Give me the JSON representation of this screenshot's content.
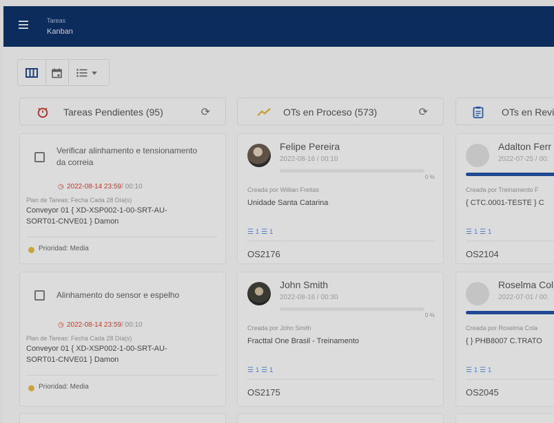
{
  "header": {
    "section": "Tareas",
    "view": "Kanban"
  },
  "toolbar": {
    "icons": [
      "kanban-view-icon",
      "calendar-view-icon",
      "list-view-icon",
      "dropdown-caret-icon"
    ]
  },
  "columns": [
    {
      "title": "Tareas Pendientes (95)",
      "icon": "timer-icon",
      "cards": [
        {
          "title_line1": "Verificar alinhamento e tensionamento",
          "title_line2": "da correia",
          "due": "2022-08-14 23:59",
          "due_suffix": "/ 00:10",
          "plan": "Plan de Tareas: Fecha Cada 28 Día(s)",
          "asset_line1": "Conveyor 01 { XD-XSP002-1-00-SRT-AU-",
          "asset_line2": "SORT01-CNVE01 } Damon",
          "priority": "Prioridad: Media"
        },
        {
          "title_line1": "Alinhamento do sensor e espelho",
          "title_line2": "",
          "due": "2022-08-14 23:59",
          "due_suffix": "/ 00:10",
          "plan": "Plan de Tareas: Fecha Cada 28 Día(s)",
          "asset_line1": "Conveyor 01 { XD-XSP002-1-00-SRT-AU-",
          "asset_line2": "SORT01-CNVE01 } Damon",
          "priority": "Prioridad: Media"
        }
      ]
    },
    {
      "title": "OTs en Proceso (573)",
      "icon": "trending-up-icon",
      "cards": [
        {
          "name": "Felipe Pereira",
          "date": "2022-08-16 / 00:10",
          "progress_label": "0 %",
          "progress": 0,
          "created_by": "Creada por Willian Freitas",
          "location": "Unidade Santa Catarina",
          "counts": "1 ☰ 1",
          "ot": "OS2176"
        },
        {
          "name": "John Smith",
          "date": "2022-08-16 / 00:30",
          "progress_label": "0 %",
          "progress": 0,
          "created_by": "Creada por John Smith",
          "location": "Fracttal One Brasil - Treinamento",
          "counts": "1 ☰ 1",
          "ot": "OS2175"
        }
      ]
    },
    {
      "title": "OTs en Revi",
      "icon": "clipboard-icon",
      "cards": [
        {
          "name": "Adalton Ferr",
          "date": "2022-07-25 / 00:",
          "progress": 1,
          "created_by": "Creada por Treinamento F",
          "location": "{ CTC.0001-TESTE } C",
          "counts": "1 ☰ 1",
          "ot": "OS2104"
        },
        {
          "name": "Roselma Col",
          "date": "2022-07-01 / 00:",
          "progress": 1,
          "created_by": "Creada por Roselma Cola",
          "location": "{ } PHB8007 C.TRATO",
          "counts": "1 ☰ 1",
          "ot": "OS2045"
        }
      ]
    }
  ],
  "colors": {
    "appbar": "#0c2c5e",
    "overdue": "#c0392b",
    "progress": "#1f4a93",
    "priority_media": "#caa33a",
    "trend": "#c99a2e"
  }
}
